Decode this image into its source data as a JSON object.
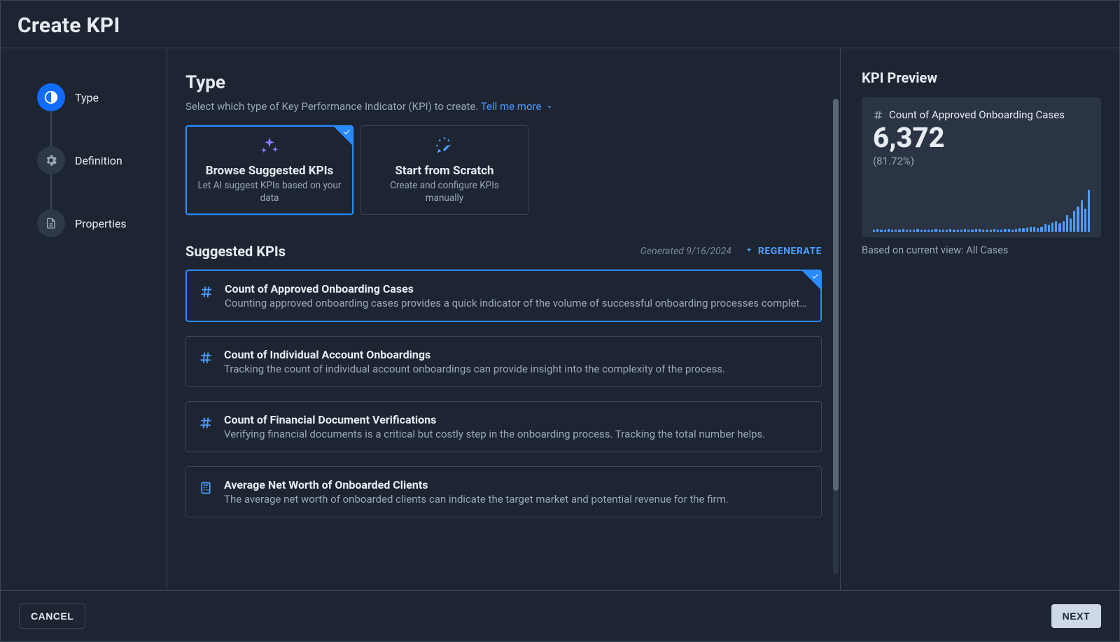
{
  "header": {
    "title": "Create KPI"
  },
  "sidebar": {
    "steps": [
      {
        "label": "Type",
        "icon": "contrast-icon",
        "active": true
      },
      {
        "label": "Definition",
        "icon": "gear-icon",
        "active": false
      },
      {
        "label": "Properties",
        "icon": "document-icon",
        "active": false
      }
    ]
  },
  "type_section": {
    "title": "Type",
    "subtitle": "Select which type of Key Performance Indicator (KPI) to create.",
    "tell_me_more": "Tell me more",
    "cards": [
      {
        "title": "Browse Suggested KPIs",
        "desc": "Let AI suggest KPIs based on your data",
        "selected": true,
        "icon": "sparkles-icon"
      },
      {
        "title": "Start from Scratch",
        "desc": "Create and configure KPIs manually",
        "selected": false,
        "icon": "magic-wand-icon"
      }
    ]
  },
  "suggested": {
    "title": "Suggested KPIs",
    "generated_label": "Generated 9/16/2024",
    "regenerate_label": "REGENERATE",
    "items": [
      {
        "title": "Count of Approved Onboarding Cases",
        "desc": "Counting approved onboarding cases provides a quick indicator of the volume of successful onboarding processes completed.",
        "icon": "hash-icon",
        "selected": true
      },
      {
        "title": "Count of Individual Account Onboardings",
        "desc": "Tracking the count of individual account onboardings can provide insight into the complexity of the process.",
        "icon": "hash-icon",
        "selected": false
      },
      {
        "title": "Count of Financial Document Verifications",
        "desc": "Verifying financial documents is a critical but costly step in the onboarding process. Tracking the total number helps.",
        "icon": "hash-icon",
        "selected": false
      },
      {
        "title": "Average Net Worth of Onboarded Clients",
        "desc": "The average net worth of onboarded clients can indicate the target market and potential revenue for the firm.",
        "icon": "calculator-icon",
        "selected": false
      }
    ]
  },
  "preview": {
    "title": "KPI Preview",
    "kpi_label": "Count of Approved Onboarding Cases",
    "kpi_value": "6,372",
    "kpi_pct": "(81.72%)",
    "note": "Based on current view: All Cases"
  },
  "chart_data": {
    "type": "bar",
    "title": "Count of Approved Onboarding Cases",
    "ylabel": "",
    "ylim": [
      0,
      60
    ],
    "values": [
      3,
      4,
      3,
      3,
      4,
      3,
      3,
      3,
      4,
      3,
      3,
      3,
      4,
      3,
      3,
      3,
      3,
      4,
      3,
      3,
      3,
      4,
      3,
      3,
      3,
      4,
      3,
      3,
      4,
      4,
      3,
      3,
      3,
      4,
      3,
      3,
      4,
      4,
      3,
      4,
      5,
      5,
      6,
      7,
      7,
      5,
      7,
      10,
      9,
      12,
      14,
      11,
      14,
      22,
      18,
      28,
      34,
      42,
      31,
      56
    ]
  },
  "footer": {
    "cancel": "CANCEL",
    "next": "NEXT"
  }
}
